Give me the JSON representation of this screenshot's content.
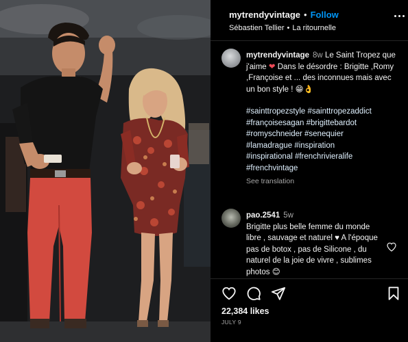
{
  "post": {
    "username": "mytrendyvintage",
    "dot": "•",
    "follow_label": "Follow",
    "audio_artist": "Sébastien Tellier",
    "audio_sep": "•",
    "audio_title": "La ritournelle",
    "more_icon": "more-horizontal-icon"
  },
  "caption": {
    "username": "mytrendyvintage",
    "time": "8w",
    "text_part1": "Le Saint Tropez que j'aime",
    "heart": "❤",
    "text_part2": "Dans le désordre : Brigitte ,Romy ,Françoise et ... des inconnues mais avec un bon style ! 😁👌",
    "hashtags": [
      "#sainttropezstyle #sainttropezaddict",
      "#françoisesagan #brigittebardot",
      "#romyschneider #senequier",
      "#lamadrague #inspiration",
      "#inspirational #frenchrivieralife",
      "#frenchvintage"
    ],
    "see_translation": "See translation"
  },
  "comment": {
    "username": "pao.2541",
    "time": "5w",
    "text": "Brigitte plus belle femme du monde libre , sauvage et naturel ♥ A l'époque pas de botox , pas de Silicone , du naturel de la joie de vivre , sublimes photos 😊"
  },
  "actions": {
    "like_icon": "heart-icon",
    "comment_icon": "comment-icon",
    "share_icon": "share-icon",
    "save_icon": "bookmark-icon",
    "likes": "22,384 likes",
    "date": "JULY 9"
  },
  "colors": {
    "background": "#000000",
    "text": "#f5f5f5",
    "follow": "#0095f6",
    "muted": "#a8a8a8",
    "heart": "#ed4956"
  }
}
